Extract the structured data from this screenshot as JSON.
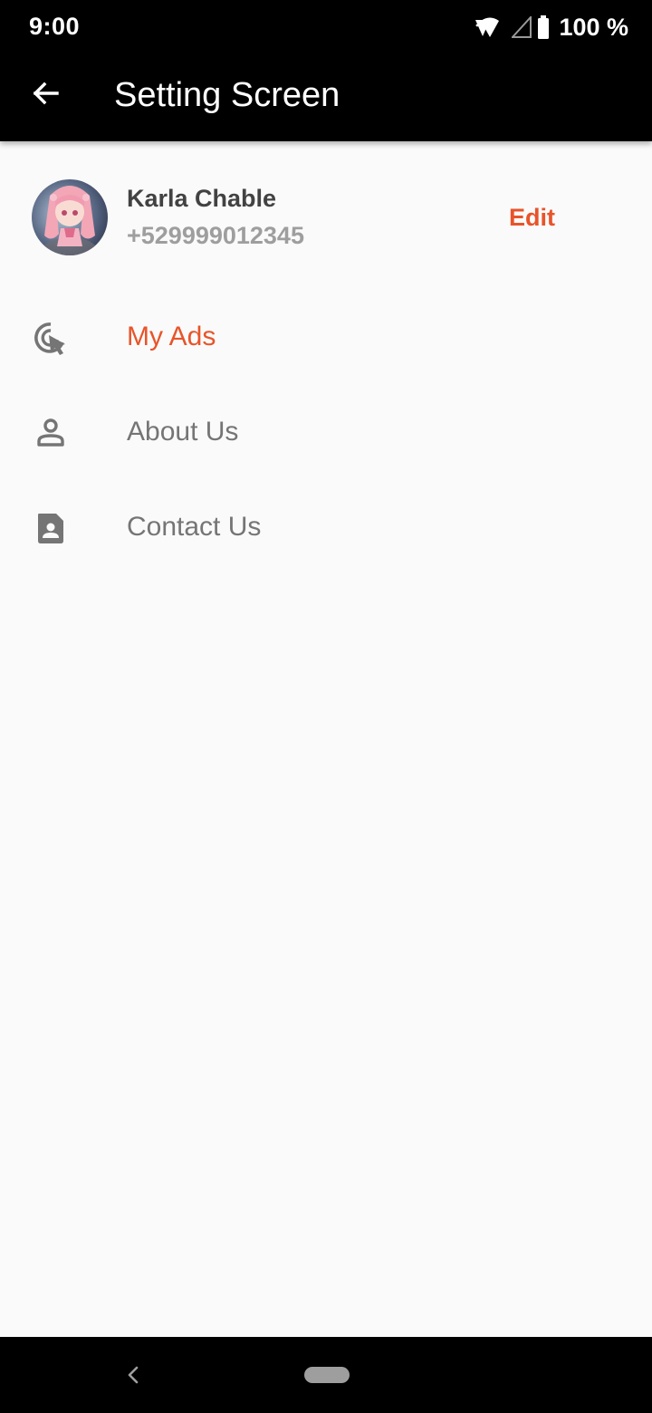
{
  "status_bar": {
    "time": "9:00",
    "battery": "100 %",
    "icons": [
      "wifi-icon",
      "signal-icon",
      "battery-icon"
    ]
  },
  "app_bar": {
    "title": "Setting Screen",
    "back_icon": "arrow-back-icon"
  },
  "profile": {
    "name": "Karla Chable",
    "phone": "+529999012345",
    "edit_label": "Edit"
  },
  "menu": {
    "items": [
      {
        "label": "My Ads",
        "icon": "ads-click-icon",
        "color": "#e8542a"
      },
      {
        "label": "About Us",
        "icon": "person-icon",
        "color": "#757575"
      },
      {
        "label": "Contact Us",
        "icon": "contact-card-icon",
        "color": "#757575"
      }
    ]
  },
  "colors": {
    "accent": "#e8542a",
    "text_primary": "#424242",
    "text_secondary": "#757575",
    "text_muted": "#9e9e9e",
    "app_bar": "#000000",
    "background": "#fafafa"
  }
}
